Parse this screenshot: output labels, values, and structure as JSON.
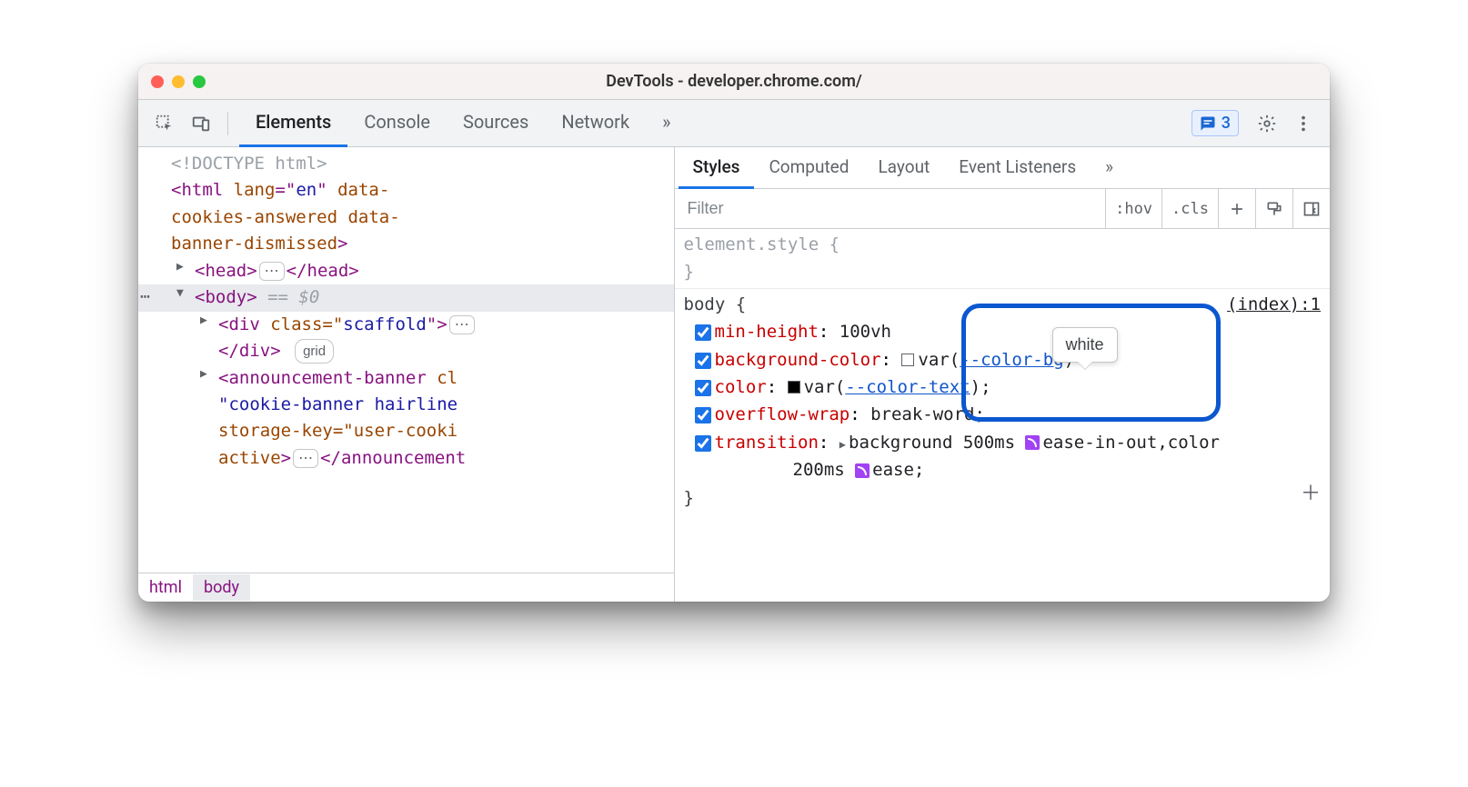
{
  "window": {
    "title": "DevTools - developer.chrome.com/"
  },
  "toolbar": {
    "main_tabs": [
      "Elements",
      "Console",
      "Sources",
      "Network"
    ],
    "more": "»",
    "issues_count": "3"
  },
  "dom": {
    "doctype": "<!DOCTYPE html>",
    "html_open_1": "<",
    "html_tag": "html",
    "html_attrs_l1_name": " lang",
    "html_attrs_l1_eq": "=\"",
    "html_attrs_l1_val": "en",
    "html_attrs_l1_close": "\"",
    "html_attrs_l1_rest": " data-",
    "html_line2": "cookies-answered data-",
    "html_line3": "banner-dismissed",
    "html_close": ">",
    "head_open": "<head>",
    "head_collapsed": "⋯",
    "head_close": "</head>",
    "body_open": "<body>",
    "body_eq": " == ",
    "body_var": "$0",
    "div_open": "<div",
    "div_attr": " class=\"",
    "div_val": "scaffold",
    "div_close_attr": "\">",
    "div_collapsed": "⋯",
    "div_close": "</div>",
    "grid_badge": "grid",
    "ann_open": "<announcement-banner",
    "ann_attr1": " cl",
    "ann_l2": "\"cookie-banner hairline",
    "ann_l3": "storage-key=\"user-cooki",
    "ann_l4_attr": "active",
    "ann_l4_gt": ">",
    "ann_collapsed": "⋯",
    "ann_close": "</announcement"
  },
  "breadcrumb": [
    "html",
    "body"
  ],
  "styles_panel": {
    "tabs": [
      "Styles",
      "Computed",
      "Layout",
      "Event Listeners"
    ],
    "more": "»",
    "filter_placeholder": "Filter",
    "hov": ":hov",
    "cls": ".cls"
  },
  "rules": {
    "element_style": "element.style {",
    "element_style_close": "}",
    "body_selector": "body {",
    "body_source": "(index):1",
    "decls": [
      {
        "prop": "min-height",
        "val": "100vh"
      },
      {
        "prop": "background-color",
        "val_prefix": "var(",
        "var": "--color-bg",
        "val_suffix": ")",
        "swatch": "white"
      },
      {
        "prop": "color",
        "val_prefix": "var(",
        "var": "--color-text",
        "val_suffix": ");",
        "swatch": "black"
      },
      {
        "prop": "overflow-wrap",
        "val": "break-word;"
      },
      {
        "prop": "transition",
        "val1": "background 500ms ",
        "ease1": "ease-in-out",
        "comma": ",color",
        "val2": "200ms ",
        "ease2": "ease;"
      }
    ],
    "body_close": "}"
  },
  "tooltip": "white"
}
